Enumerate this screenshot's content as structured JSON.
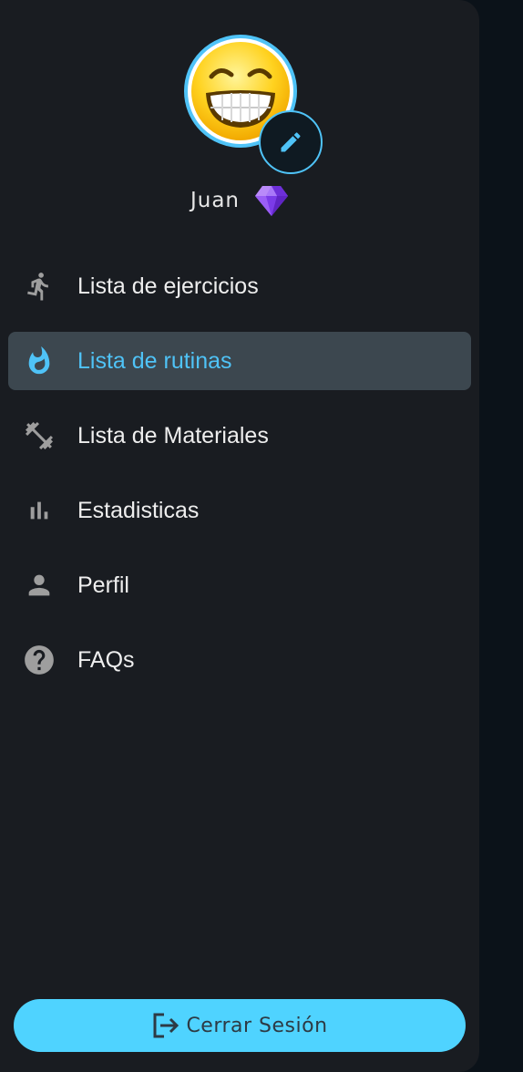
{
  "profile": {
    "name": "Juan",
    "avatar_icon": "grinning-emoji",
    "edit_icon": "pencil-icon",
    "badge_icon": "diamond-icon"
  },
  "menu": {
    "items": [
      {
        "label": "Lista de ejercicios",
        "icon": "running-icon",
        "active": false
      },
      {
        "label": "Lista de rutinas",
        "icon": "fire-icon",
        "active": true
      },
      {
        "label": "Lista de Materiales",
        "icon": "dumbbell-icon",
        "active": false
      },
      {
        "label": "Estadisticas",
        "icon": "bar-chart-icon",
        "active": false
      },
      {
        "label": "Perfil",
        "icon": "person-icon",
        "active": false
      },
      {
        "label": "FAQs",
        "icon": "help-icon",
        "active": false
      }
    ]
  },
  "logout": {
    "label": "Cerrar Sesión",
    "icon": "logout-icon"
  },
  "colors": {
    "accent": "#4fc3f7",
    "drawer_bg": "#191c21",
    "active_bg": "#3c474f",
    "logout_bg": "#4fd3ff"
  }
}
